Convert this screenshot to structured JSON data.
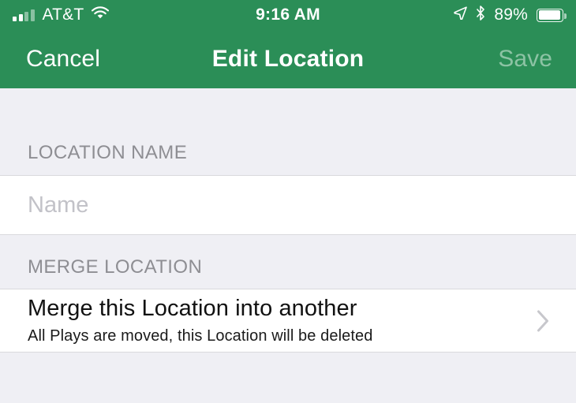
{
  "theme": {
    "accent": "#2b8e57",
    "background": "#efeff4",
    "cell_background": "#ffffff",
    "separator": "#d9d9dd",
    "header_text": "#8e8e93",
    "disabled_text": "#8cc3a4",
    "placeholder_text": "#c2c2c8",
    "chevron": "#c7c7cc"
  },
  "status_bar": {
    "carrier": "AT&T",
    "time": "9:16 AM",
    "battery_percent": "89%",
    "battery_level": 89,
    "signal_bars_filled": 2,
    "signal_bars_total": 4,
    "icons": {
      "signal": "signal-bars-icon",
      "wifi": "wifi-icon",
      "location": "location-arrow-icon",
      "bluetooth": "bluetooth-icon",
      "battery": "battery-icon"
    }
  },
  "nav_bar": {
    "cancel_label": "Cancel",
    "title": "Edit Location",
    "save_label": "Save",
    "save_enabled": false
  },
  "form": {
    "sections": [
      {
        "header": "LOCATION NAME",
        "field": {
          "name": "location-name",
          "value": "",
          "placeholder": "Name"
        }
      },
      {
        "header": "MERGE LOCATION",
        "row": {
          "title": "Merge this Location into another",
          "subtitle": "All Plays are moved, this Location will be deleted",
          "accessory": "chevron-right-icon"
        }
      }
    ]
  }
}
